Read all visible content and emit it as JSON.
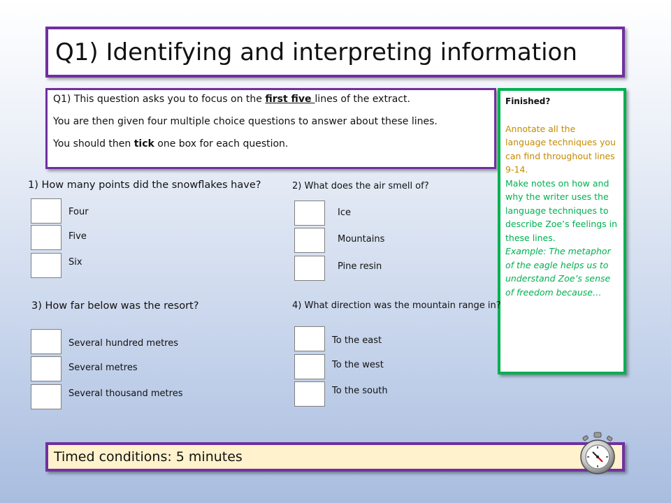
{
  "title": "Q1) Identifying and interpreting information",
  "intro": {
    "line1_pre": "Q1) This question asks you to focus on the ",
    "line1_bold": "first five ",
    "line1_post": "lines of the extract.",
    "line2": "You are then given four multiple choice questions to answer about these lines.",
    "line3_pre": "You should then ",
    "line3_bold": "tick",
    "line3_post": " one box for each question."
  },
  "questions": [
    {
      "title": "1) How many points did the snowflakes have?",
      "options": [
        "Four",
        "Five",
        "Six"
      ]
    },
    {
      "title": "2) What does the air smell of?",
      "options": [
        "Ice",
        "Mountains",
        "Pine resin"
      ]
    },
    {
      "title": "3) How far below was the resort?",
      "options": [
        "Several hundred metres",
        "Several metres",
        "Several thousand metres"
      ]
    },
    {
      "title": "4) What direction was the mountain range in?",
      "options": [
        "To the east",
        "To the west",
        "To the south"
      ]
    }
  ],
  "finished": {
    "heading": "Finished?",
    "task1": "Annotate all the language techniques you can find throughout lines 9-14.",
    "task2": "Make notes on how and why the writer uses the language techniques to describe Zoe’s feelings in these lines.",
    "example": "Example: The metaphor of the eagle helps us to understand Zoe’s sense of freedom because…"
  },
  "timer": "Timed conditions: 5 minutes",
  "icons": {
    "stopwatch": "stopwatch-icon"
  },
  "colors": {
    "purple_border": "#7030a0",
    "green_border": "#00b050",
    "orange_text": "#c58a00",
    "timer_bg": "#fff2cc"
  }
}
